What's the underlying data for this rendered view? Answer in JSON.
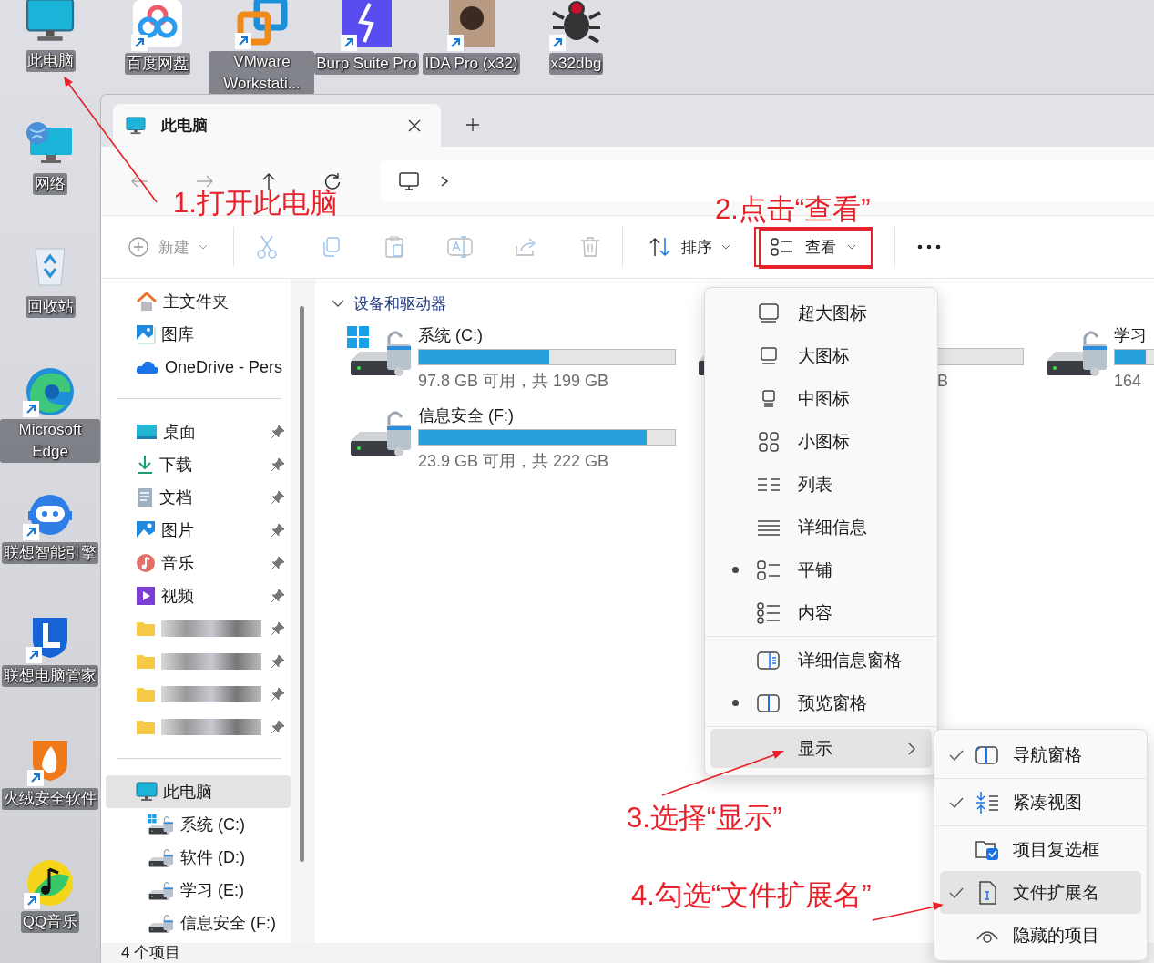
{
  "desktop_left": [
    {
      "label": "此电脑",
      "shortcut": false
    },
    {
      "label": "网络",
      "shortcut": false
    },
    {
      "label": "回收站",
      "shortcut": false
    },
    {
      "label": "Microsoft Edge",
      "shortcut": true
    },
    {
      "label": "联想智能引擎",
      "shortcut": true
    },
    {
      "label": "联想电脑管家",
      "shortcut": true
    },
    {
      "label": "火绒安全软件",
      "shortcut": true
    },
    {
      "label": "QQ音乐",
      "shortcut": true
    }
  ],
  "desktop_top": [
    {
      "label": "百度网盘",
      "shortcut": true
    },
    {
      "label": "VMware Workstati...",
      "shortcut": true
    },
    {
      "label": "Burp Suite Pro",
      "shortcut": true
    },
    {
      "label": "IDA Pro (x32)",
      "shortcut": true
    },
    {
      "label": "x32dbg",
      "shortcut": true
    }
  ],
  "explorer": {
    "tab": {
      "title": "此电脑"
    },
    "toolbar": {
      "new": {
        "label": "新建",
        "disabled": true
      },
      "sort": "排序",
      "view": "查看"
    },
    "sidebar": {
      "groups": [
        [
          {
            "label": "主文件夹",
            "kind": "home",
            "selected": false
          },
          {
            "label": "图库",
            "kind": "gallery",
            "selected": false
          },
          {
            "label": "OneDrive - Pers",
            "kind": "cloud",
            "selected": false
          }
        ],
        [
          {
            "label": "桌面",
            "kind": "desktop",
            "pinned": true,
            "selected": false
          },
          {
            "label": "下载",
            "kind": "download",
            "pinned": true,
            "selected": false
          },
          {
            "label": "文档",
            "kind": "documents",
            "pinned": true,
            "selected": false
          },
          {
            "label": "图片",
            "kind": "pictures",
            "pinned": true,
            "selected": false
          },
          {
            "label": "音乐",
            "kind": "music",
            "pinned": true,
            "selected": false
          },
          {
            "label": "视频",
            "kind": "videos",
            "pinned": true,
            "selected": false
          },
          {
            "kind": "redacted",
            "pinned": true,
            "selected": false
          },
          {
            "kind": "redacted",
            "pinned": true,
            "selected": false
          },
          {
            "kind": "redacted",
            "pinned": true,
            "selected": false
          },
          {
            "kind": "redacted",
            "pinned": true,
            "selected": false
          }
        ],
        [
          {
            "label": "此电脑",
            "kind": "pc",
            "selected": true,
            "children": [
              {
                "label": "系统 (C:)",
                "kind": "system-drive",
                "selected": false
              },
              {
                "label": "软件 (D:)",
                "kind": "drive",
                "selected": false
              },
              {
                "label": "学习 (E:)",
                "kind": "drive",
                "selected": false
              },
              {
                "label": "信息安全 (F:)",
                "kind": "drive",
                "selected": false
              }
            ]
          }
        ]
      ]
    },
    "section": {
      "title": "设备和驱动器",
      "expanded": true
    },
    "drives": [
      {
        "kind": "system",
        "name": "系统 (C:)",
        "level": 0.51,
        "usage": "97.8 GB 可用，共 199 GB"
      },
      {
        "kind": "covered",
        "usage": "B"
      },
      {
        "kind": "drive",
        "name": "学习",
        "level": 0.12,
        "usage": "164"
      },
      {
        "kind": "drive",
        "name": "信息安全 (F:)",
        "level": 0.89,
        "usage": "23.9 GB 可用，共 222 GB"
      }
    ],
    "status_bar": "4 个项目"
  },
  "view_menu": {
    "groups": [
      [
        {
          "label": "超大图标",
          "selected": false
        },
        {
          "label": "大图标",
          "selected": false
        },
        {
          "label": "中图标",
          "selected": false
        },
        {
          "label": "小图标",
          "selected": false
        },
        {
          "label": "列表",
          "selected": false
        },
        {
          "label": "详细信息",
          "selected": false
        },
        {
          "label": "平铺",
          "selected": true
        },
        {
          "label": "内容",
          "selected": false
        }
      ],
      [
        {
          "label": "详细信息窗格",
          "selected": false
        },
        {
          "label": "预览窗格",
          "selected": true
        }
      ],
      [
        {
          "label": "显示",
          "kind": "submenu",
          "highlighted": true,
          "selected": false
        }
      ]
    ]
  },
  "show_submenu": {
    "groups": [
      [
        {
          "label": "导航窗格",
          "checked": true,
          "highlighted": false
        }
      ],
      [
        {
          "label": "紧凑视图",
          "checked": true,
          "highlighted": false
        }
      ],
      [
        {
          "label": "项目复选框",
          "checked": false,
          "highlighted": false
        },
        {
          "label": "文件扩展名",
          "checked": true,
          "highlighted": true
        },
        {
          "label": "隐藏的项目",
          "checked": false,
          "highlighted": false
        }
      ]
    ]
  },
  "annotations": [
    "1.打开此电脑",
    "2.点击“查看”",
    "3.选择“显示”",
    "4.勾选“文件扩展名”"
  ]
}
